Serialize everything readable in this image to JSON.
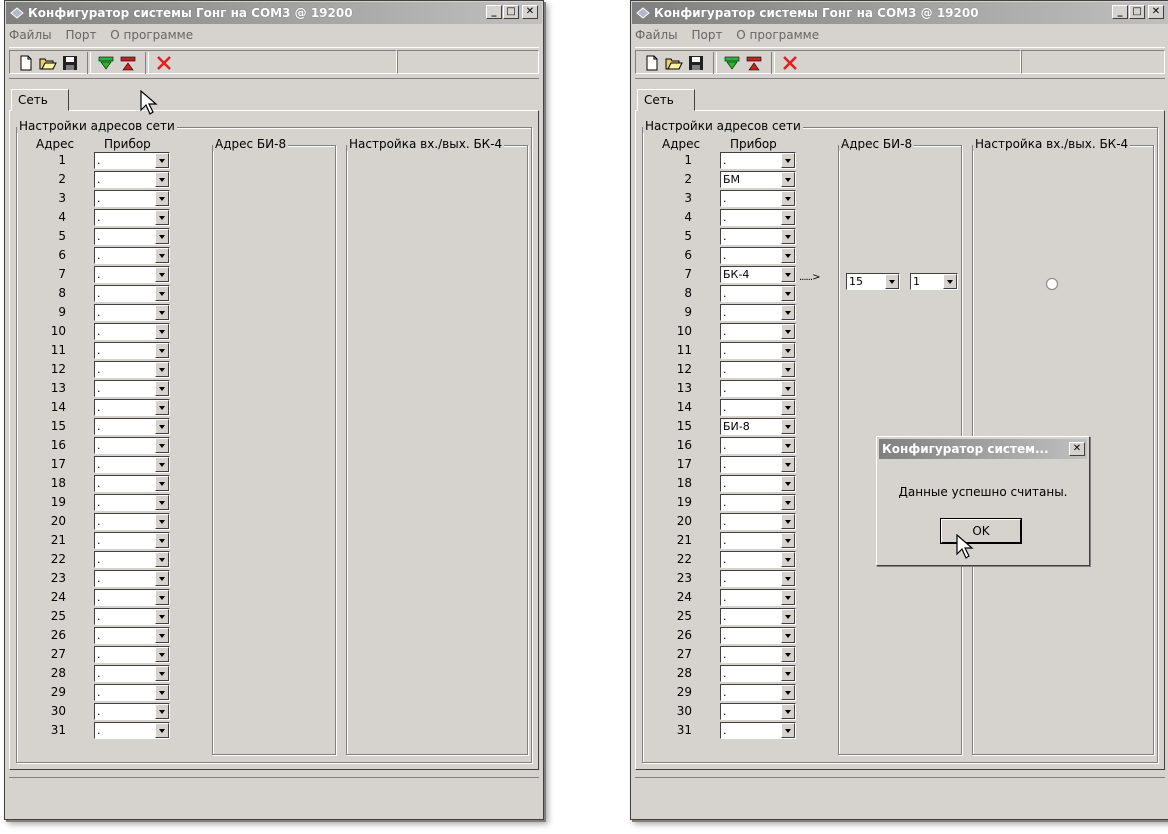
{
  "window_title": "Конфигуратор системы Гонг на COM3 @ 19200",
  "title_buttons": {
    "minimize": "_",
    "maximize": "□",
    "close": "✕"
  },
  "menu": [
    "Файлы",
    "Порт",
    "О программе"
  ],
  "tab_label": "Сеть",
  "group_network": "Настройки адресов сети",
  "col_address": "Адрес",
  "col_device": "Прибор",
  "group_bi8": "Адрес БИ-8",
  "group_bk4": "Настройка вх./вых. БК-4",
  "addresses": [
    "1",
    "2",
    "3",
    "4",
    "5",
    "6",
    "7",
    "8",
    "9",
    "10",
    "11",
    "12",
    "13",
    "14",
    "15",
    "16",
    "17",
    "18",
    "19",
    "20",
    "21",
    "22",
    "23",
    "24",
    "25",
    "26",
    "27",
    "28",
    "29",
    "30",
    "31"
  ],
  "left_devices": [
    ".",
    ".",
    ".",
    ".",
    ".",
    ".",
    ".",
    ".",
    ".",
    ".",
    ".",
    ".",
    ".",
    ".",
    ".",
    ".",
    ".",
    ".",
    ".",
    ".",
    ".",
    ".",
    ".",
    ".",
    ".",
    ".",
    ".",
    ".",
    ".",
    ".",
    "."
  ],
  "right_devices": [
    ".",
    "БМ",
    ".",
    ".",
    ".",
    ".",
    "БК-4",
    ".",
    ".",
    ".",
    ".",
    ".",
    ".",
    ".",
    "БИ-8",
    ".",
    ".",
    ".",
    ".",
    ".",
    ".",
    ".",
    ".",
    ".",
    ".",
    ".",
    ".",
    ".",
    ".",
    ".",
    "."
  ],
  "bi8_address_value": "15",
  "bi8_second_value": "1",
  "arrow_text": "......>",
  "dialog": {
    "title": "Конфигуратор систем...",
    "message": "Данные успешно считаны.",
    "ok": "OK",
    "close": "✕"
  },
  "colors": {
    "titlebar": "#808080",
    "face": "#d6d3ce",
    "read_icon": "#2db52d",
    "write_icon": "#cc1f1f",
    "delete_icon": "#e02020"
  },
  "icons": [
    "new-file-icon",
    "open-folder-icon",
    "save-disk-icon",
    "read-device-icon",
    "write-device-icon",
    "delete-icon"
  ]
}
